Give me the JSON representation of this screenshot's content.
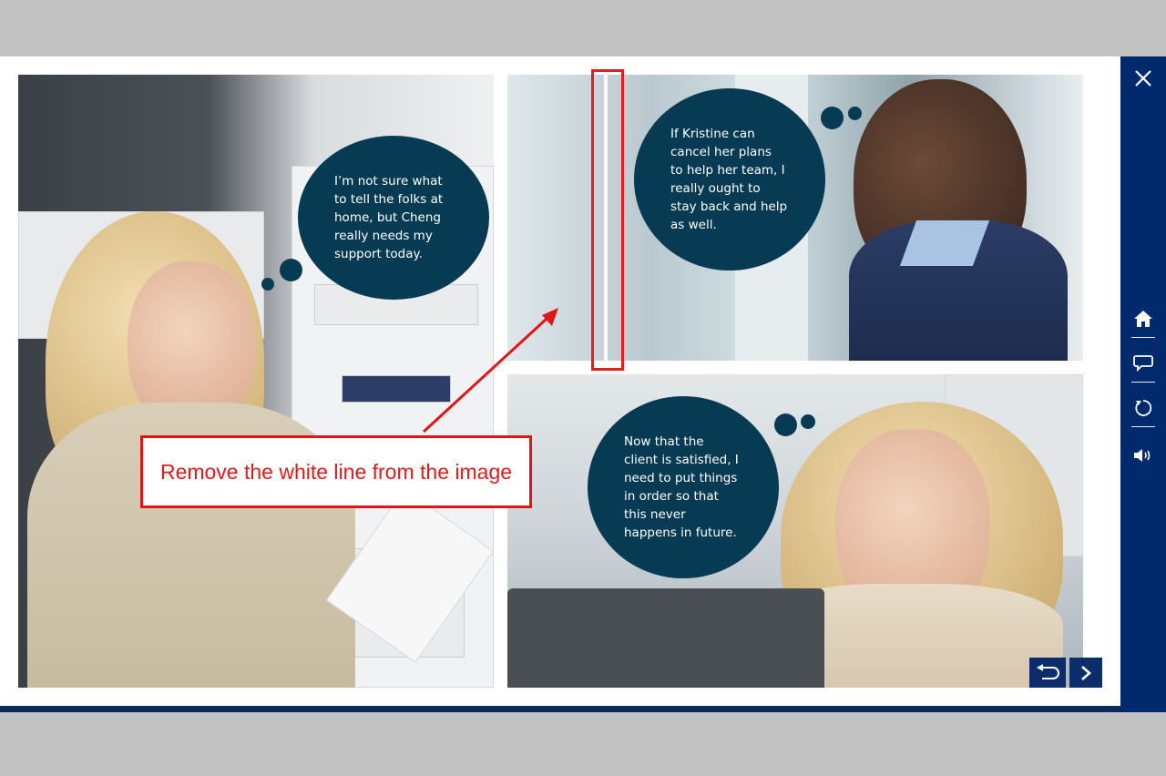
{
  "bubbles": {
    "left": "I’m not sure what\nto tell the folks at\nhome, but Cheng\nreally needs my\nsupport today.",
    "top_right": "If Kristine can\ncancel her plans\nto help her team, I\nreally ought to\nstay back and help\nas well.",
    "bottom_right": "Now that the\nclient is satisfied, I\nneed to put things\nin order so that\nthis never\nhappens in future."
  },
  "annotation": {
    "callout_text": "Remove the white line from the image",
    "color": "#e11515"
  },
  "sidebar": {
    "icons": [
      "close-icon",
      "home-icon",
      "chat-icon",
      "replay-icon",
      "volume-icon"
    ]
  },
  "navigation": {
    "icons": [
      "back-icon",
      "next-icon"
    ]
  },
  "colors": {
    "sidebar_bg": "#002a6b",
    "bubble_bg": "#073b53",
    "page_bg": "#c2c2c2"
  }
}
